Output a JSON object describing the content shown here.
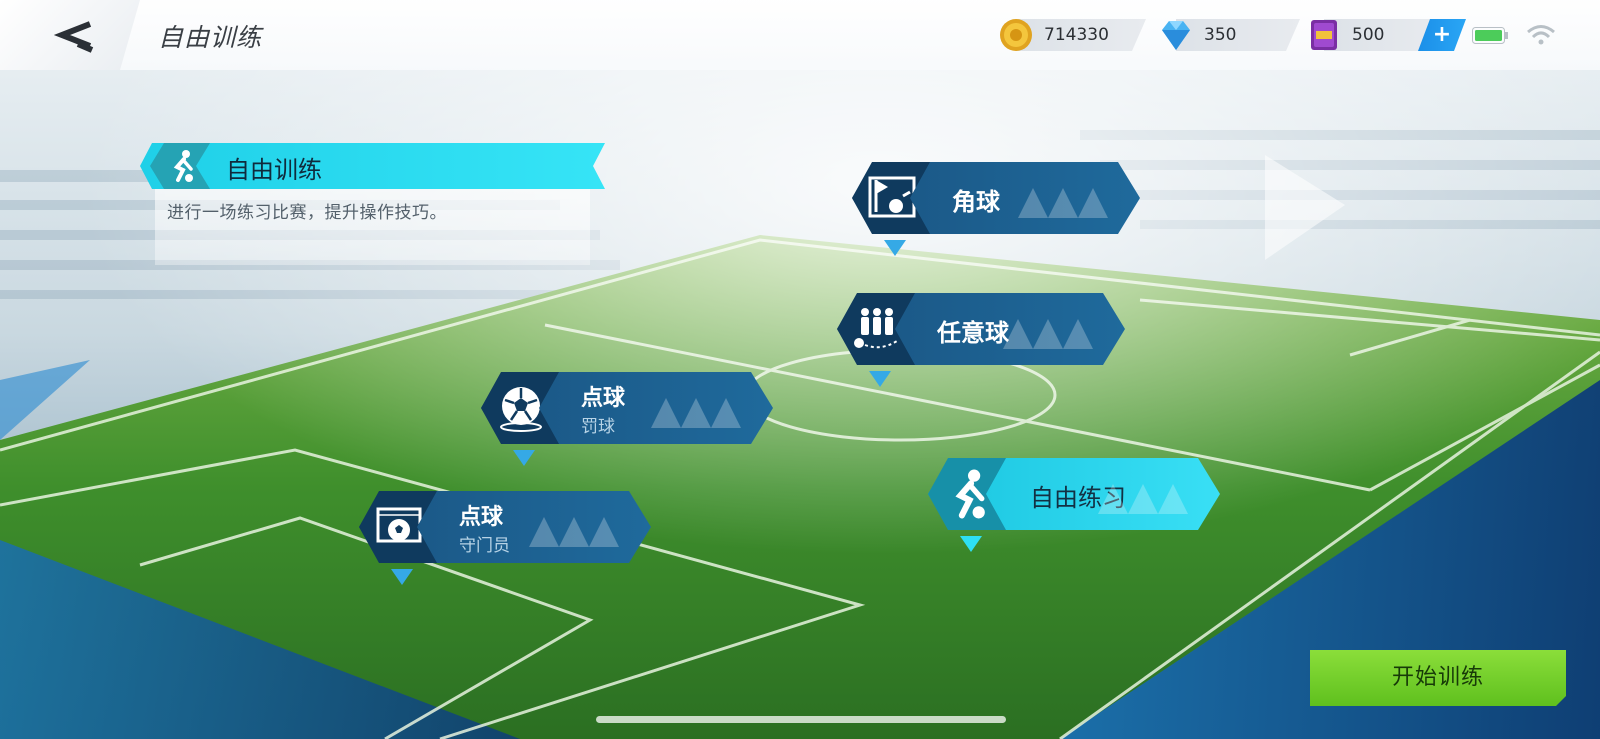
{
  "header": {
    "title": "自由训练",
    "resources": [
      {
        "icon": "gold-coin-icon",
        "value": "714330"
      },
      {
        "icon": "diamond-icon",
        "value": "350"
      },
      {
        "icon": "cof-card-icon",
        "value": "500"
      }
    ],
    "plus_label": "+"
  },
  "info": {
    "title": "自由训练",
    "description": "进行一场练习比赛，提升操作技巧。"
  },
  "modes": [
    {
      "id": "corner",
      "label": "角球",
      "icon": "corner-flag-icon"
    },
    {
      "id": "free-kick",
      "label": "任意球",
      "icon": "defensive-wall-icon"
    },
    {
      "id": "penalty-kick",
      "label": "点球",
      "sub": "罚球",
      "icon": "ball-icon"
    },
    {
      "id": "penalty-keeper",
      "label": "点球",
      "sub": "守门员",
      "icon": "goal-icon"
    },
    {
      "id": "free-practice",
      "label": "自由练习",
      "icon": "kicking-player-icon",
      "active": true
    }
  ],
  "start_label": "开始训练",
  "colors": {
    "accent_cyan": "#2fdcf2",
    "node_blue": "#1a5583",
    "start_green": "#72cf2a",
    "pitch_green": "#3f9a2e"
  }
}
